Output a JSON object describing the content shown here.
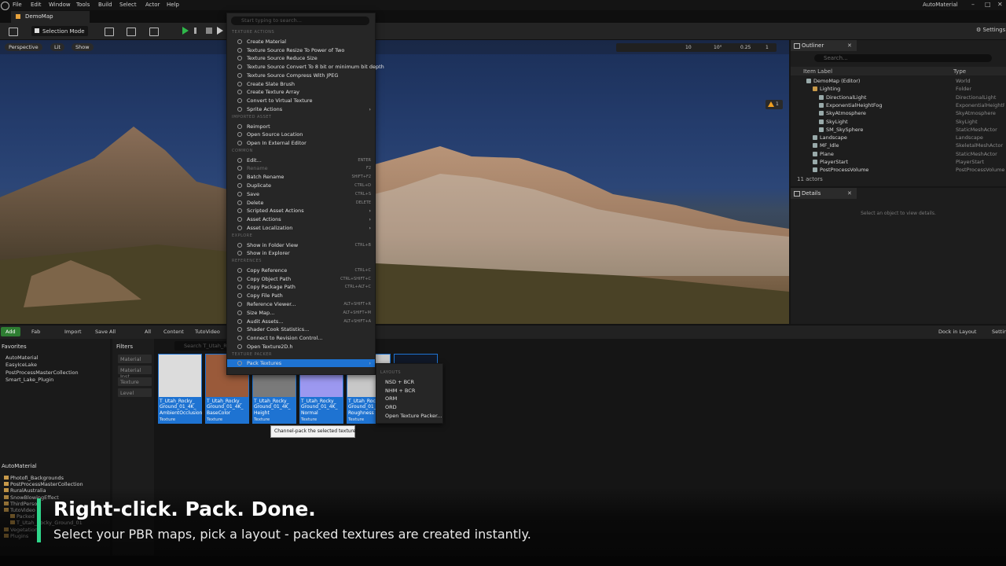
{
  "menubar": {
    "items": [
      "File",
      "Edit",
      "Window",
      "Tools",
      "Build",
      "Select",
      "Actor",
      "Help"
    ],
    "project": "AutoMaterial"
  },
  "tab": {
    "title": "DemoMap"
  },
  "toolbar": {
    "selection_mode": "Selection Mode",
    "settings": "Settings"
  },
  "viewport": {
    "perspective": "Perspective",
    "lit": "Lit",
    "show": "Show",
    "grid_snap": "10",
    "rot_snap": "10°",
    "scale_snap": "0.25",
    "camera": "1",
    "warnings": "1"
  },
  "outliner": {
    "tab": "Outliner",
    "search_placeholder": "Search...",
    "col_label": "Item Label",
    "col_type": "Type",
    "rows": [
      {
        "label": "DemoMap (Editor)",
        "type": "World",
        "indent": 0
      },
      {
        "label": "Lighting",
        "type": "Folder",
        "indent": 1
      },
      {
        "label": "DirectionalLight",
        "type": "DirectionalLight",
        "indent": 2
      },
      {
        "label": "ExponentialHeightFog",
        "type": "ExponentialHeightFog",
        "indent": 2
      },
      {
        "label": "SkyAtmosphere",
        "type": "SkyAtmosphere",
        "indent": 2
      },
      {
        "label": "SkyLight",
        "type": "SkyLight",
        "indent": 2
      },
      {
        "label": "SM_SkySphere",
        "type": "StaticMeshActor",
        "indent": 2
      },
      {
        "label": "Landscape",
        "type": "Landscape",
        "indent": 1
      },
      {
        "label": "MF_Idle",
        "type": "SkeletalMeshActor",
        "indent": 1
      },
      {
        "label": "Plane",
        "type": "StaticMeshActor",
        "indent": 1
      },
      {
        "label": "PlayerStart",
        "type": "PlayerStart",
        "indent": 1
      },
      {
        "label": "PostProcessVolume",
        "type": "PostProcessVolume",
        "indent": 1
      }
    ],
    "footer": "11 actors"
  },
  "details": {
    "tab": "Details",
    "message": "Select an object to view details."
  },
  "content_browser": {
    "add": "Add",
    "fab": "Fab",
    "import": "Import",
    "save_all": "Save All",
    "breadcrumb": [
      "All",
      "Content",
      "TutoVideo"
    ],
    "dock": "Dock in Layout",
    "settings": "Settings",
    "favorites_header": "Favorites",
    "favorites": [
      "AutoMaterial",
      "EasyIceLake",
      "PostProcessMasterCollection",
      "Smart_Lake_Plugin"
    ],
    "tree_header": "AutoMaterial",
    "tree": [
      "Photofi_Backgrounds",
      "PostProcessMasterCollection",
      "RuralAustralia",
      "SnowBlowingEffect",
      "ThirdPerson",
      "TutoVideo",
      "Packed",
      "T_Utah_Rocky_Ground_01",
      "Vegetation",
      "Plugins"
    ],
    "filters_header": "Filters",
    "filters": [
      "Material",
      "Material Inst",
      "Texture",
      "Level"
    ],
    "search_placeholder": "Search T_Utah_R",
    "assets": [
      {
        "name": "T_Utah_Rocky_\nGround_01_4K_\nAmbientOcclusion",
        "type": "Texture",
        "color": "#dcdcdc"
      },
      {
        "name": "T_Utah_Rocky_\nGround_01_4K_\nBaseColor",
        "type": "Texture",
        "color": "#9a5a3a"
      },
      {
        "name": "T_Utah_Rocky_\nGround_01_4K_\nHeight",
        "type": "Texture",
        "color": "#7a7a7a"
      },
      {
        "name": "T_Utah_Rocky_\nGround_01_4K_\nNormal",
        "type": "Texture",
        "color": "#9c98f0"
      },
      {
        "name": "T_Utah_Rocky_\nGround_01_4K_\nRoughness",
        "type": "Texture",
        "color": "#c8c8c8"
      }
    ]
  },
  "context_menu": {
    "search_placeholder": "Start typing to search...",
    "sections": [
      {
        "title": "TEXTURE ACTIONS",
        "items": [
          {
            "label": "Create Material"
          },
          {
            "label": "Texture Source Resize To Power of Two"
          },
          {
            "label": "Texture Source Reduce Size"
          },
          {
            "label": "Texture Source Convert To 8 bit or minimum bit depth"
          },
          {
            "label": "Texture Source Compress With JPEG"
          },
          {
            "label": "Create Slate Brush"
          },
          {
            "label": "Create Texture Array"
          },
          {
            "label": "Convert to Virtual Texture"
          },
          {
            "label": "Sprite Actions",
            "submenu": true
          }
        ]
      },
      {
        "title": "IMPORTED ASSET",
        "items": [
          {
            "label": "Reimport"
          },
          {
            "label": "Open Source Location"
          },
          {
            "label": "Open In External Editor"
          }
        ]
      },
      {
        "title": "COMMON",
        "items": [
          {
            "label": "Edit...",
            "shortcut": "ENTER"
          },
          {
            "label": "Rename",
            "shortcut": "F2",
            "disabled": true
          },
          {
            "label": "Batch Rename",
            "shortcut": "SHIFT+F2"
          },
          {
            "label": "Duplicate",
            "shortcut": "CTRL+D"
          },
          {
            "label": "Save",
            "shortcut": "CTRL+S"
          },
          {
            "label": "Delete",
            "shortcut": "DELETE"
          },
          {
            "label": "Scripted Asset Actions",
            "submenu": true
          },
          {
            "label": "Asset Actions",
            "submenu": true
          },
          {
            "label": "Asset Localization",
            "submenu": true
          }
        ]
      },
      {
        "title": "EXPLORE",
        "items": [
          {
            "label": "Show in Folder View",
            "shortcut": "CTRL+B"
          },
          {
            "label": "Show in Explorer"
          }
        ]
      },
      {
        "title": "REFERENCES",
        "items": [
          {
            "label": "Copy Reference",
            "shortcut": "CTRL+C"
          },
          {
            "label": "Copy Object Path",
            "shortcut": "CTRL+SHIFT+C"
          },
          {
            "label": "Copy Package Path",
            "shortcut": "CTRL+ALT+C"
          },
          {
            "label": "Copy File Path"
          },
          {
            "label": "Reference Viewer...",
            "shortcut": "ALT+SHIFT+R"
          },
          {
            "label": "Size Map...",
            "shortcut": "ALT+SHIFT+M"
          },
          {
            "label": "Audit Assets...",
            "shortcut": "ALT+SHIFT+A"
          },
          {
            "label": "Shader Cook Statistics..."
          },
          {
            "label": "Connect to Revision Control..."
          },
          {
            "label": "Open Texture2D.h"
          }
        ]
      },
      {
        "title": "TEXTURE PACKER",
        "items": [
          {
            "label": "Pack Textures",
            "submenu": true,
            "highlighted": true
          }
        ]
      }
    ]
  },
  "submenu": {
    "title": "LAYOUTS",
    "items": [
      "NSD + BCR",
      "NHM + BCR",
      "ORM",
      "ORD",
      "Open Texture Packer..."
    ]
  },
  "tooltip": "Channel-pack the selected textures.",
  "caption": {
    "title": "Right-click. Pack. Done.",
    "subtitle": "Select your PBR maps, pick a layout - packed textures are created instantly.",
    "accent": "#2fd58a"
  }
}
